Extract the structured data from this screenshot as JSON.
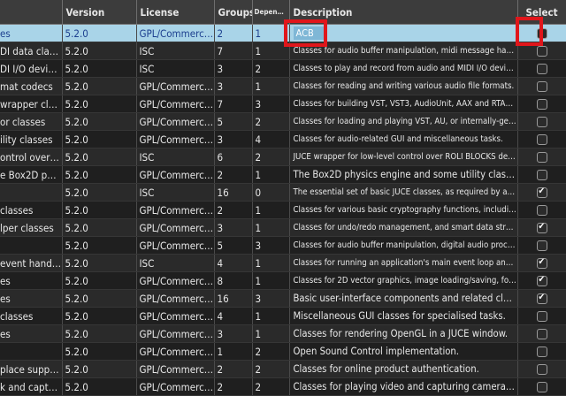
{
  "columns": {
    "name": "",
    "version": "Version",
    "license": "License",
    "groups": "Groups",
    "dependencies": "Depen…",
    "description": "Description",
    "select": "Select"
  },
  "rows": [
    {
      "name": "es",
      "version": "5.2.0",
      "license": "GPL/Commercial",
      "groups": "2",
      "deps": "1",
      "description": "ACB",
      "checked": false,
      "selected": true,
      "editing": true
    },
    {
      "name": "DI data classes",
      "version": "5.2.0",
      "license": "ISC",
      "groups": "7",
      "deps": "1",
      "description": "Classes for audio buffer manipulation, midi message handling, …",
      "checked": false
    },
    {
      "name": "DI I/O devic…",
      "version": "5.2.0",
      "license": "ISC",
      "groups": "3",
      "deps": "2",
      "description": "Classes to play and record from audio and MIDI I/O devices.",
      "checked": false
    },
    {
      "name": "mat codecs",
      "version": "5.2.0",
      "license": "GPL/Commercial",
      "groups": "3",
      "deps": "1",
      "description": "Classes for reading and writing various audio file formats.",
      "checked": false
    },
    {
      "name": "wrapper clas…",
      "version": "5.2.0",
      "license": "GPL/Commercial",
      "groups": "7",
      "deps": "3",
      "description": "Classes for building VST, VST3, AudioUnit, AAX and RTAS plugins.",
      "checked": false
    },
    {
      "name": "or classes",
      "version": "5.2.0",
      "license": "GPL/Commercial",
      "groups": "5",
      "deps": "2",
      "description": "Classes for loading and playing VST, AU, or internally-generate…",
      "checked": false
    },
    {
      "name": "ility classes",
      "version": "5.2.0",
      "license": "GPL/Commercial",
      "groups": "3",
      "deps": "4",
      "description": "Classes for audio-related GUI and miscellaneous tasks.",
      "checked": false
    },
    {
      "name": "ontrol over …",
      "version": "5.2.0",
      "license": "ISC",
      "groups": "6",
      "deps": "2",
      "description": "JUCE wrapper for low-level control over ROLI BLOCKS devices.",
      "checked": false
    },
    {
      "name": "e Box2D p…",
      "version": "5.2.0",
      "license": "GPL/Commercial",
      "groups": "2",
      "deps": "1",
      "description": "The Box2D physics engine and some utility classes.",
      "checked": false
    },
    {
      "name": "",
      "version": "5.2.0",
      "license": "ISC",
      "groups": "16",
      "deps": "0",
      "description": "The essential set of basic JUCE classes, as required by all the o…",
      "checked": true
    },
    {
      "name": "classes",
      "version": "5.2.0",
      "license": "GPL/Commercial",
      "groups": "2",
      "deps": "1",
      "description": "Classes for various basic cryptography functions, including RSA…",
      "checked": false
    },
    {
      "name": "lper classes",
      "version": "5.2.0",
      "license": "GPL/Commercial",
      "groups": "3",
      "deps": "1",
      "description": "Classes for undo/redo management, and smart data structures.",
      "checked": true
    },
    {
      "name": "",
      "version": "5.2.0",
      "license": "GPL/Commercial",
      "groups": "5",
      "deps": "3",
      "description": "Classes for audio buffer manipulation, digital audio processing,…",
      "checked": false
    },
    {
      "name": "event handi…",
      "version": "5.2.0",
      "license": "ISC",
      "groups": "4",
      "deps": "1",
      "description": "Classes for running an application's main event loop and sendi…",
      "checked": true
    },
    {
      "name": "es",
      "version": "5.2.0",
      "license": "GPL/Commercial",
      "groups": "8",
      "deps": "1",
      "description": "Classes for 2D vector graphics, image loading/saving, font han…",
      "checked": true
    },
    {
      "name": "es",
      "version": "5.2.0",
      "license": "GPL/Commercial",
      "groups": "16",
      "deps": "3",
      "description": "Basic user-interface components and related classes.",
      "checked": true
    },
    {
      "name": "classes",
      "version": "5.2.0",
      "license": "GPL/Commercial",
      "groups": "4",
      "deps": "1",
      "description": "Miscellaneous GUI classes for specialised tasks.",
      "checked": false
    },
    {
      "name": "es",
      "version": "5.2.0",
      "license": "GPL/Commercial",
      "groups": "3",
      "deps": "1",
      "description": "Classes for rendering OpenGL in a JUCE window.",
      "checked": false
    },
    {
      "name": "",
      "version": "5.2.0",
      "license": "GPL/Commercial",
      "groups": "1",
      "deps": "2",
      "description": "Open Sound Control implementation.",
      "checked": false
    },
    {
      "name": "place support",
      "version": "5.2.0",
      "license": "GPL/Commercial",
      "groups": "2",
      "deps": "2",
      "description": "Classes for online product authentication.",
      "checked": false
    },
    {
      "name": "k and captu…",
      "version": "5.2.0",
      "license": "GPL/Commercial",
      "groups": "2",
      "deps": "2",
      "description": "Classes for playing video and capturing camera input.",
      "checked": false
    }
  ]
}
